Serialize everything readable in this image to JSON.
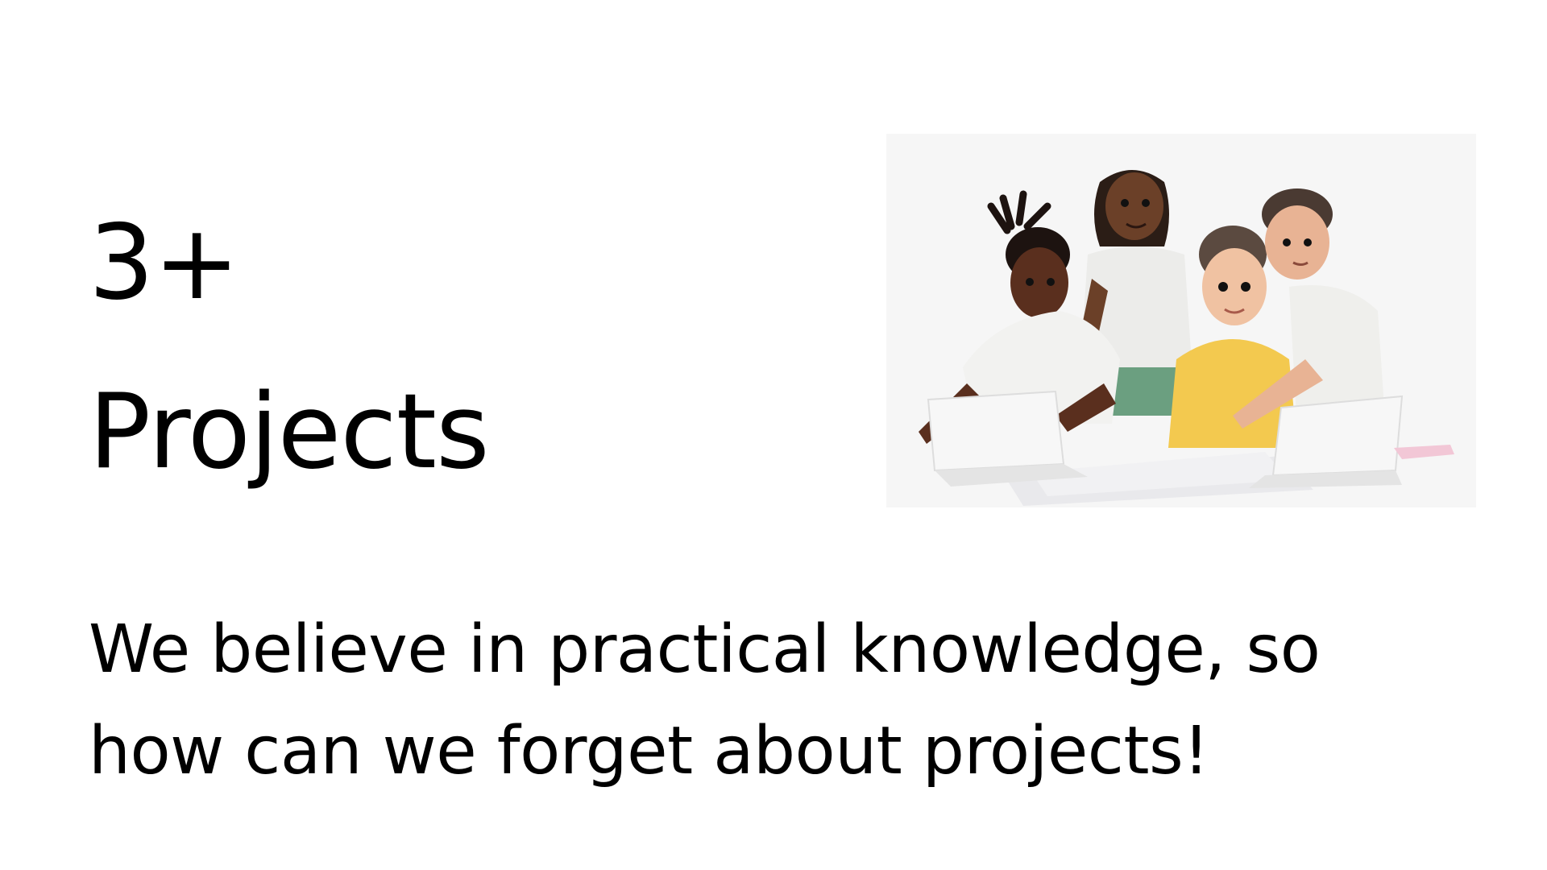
{
  "hero": {
    "count": "3+",
    "label": "Projects",
    "illustration_icon": "team-collaboration-illustration"
  },
  "description": {
    "line1": "We believe in practical knowledge, so",
    "line2": "how can we forget about projects!"
  },
  "colors": {
    "background": "#ffffff",
    "text": "#000000",
    "illustration_background": "#f6f6f6"
  }
}
